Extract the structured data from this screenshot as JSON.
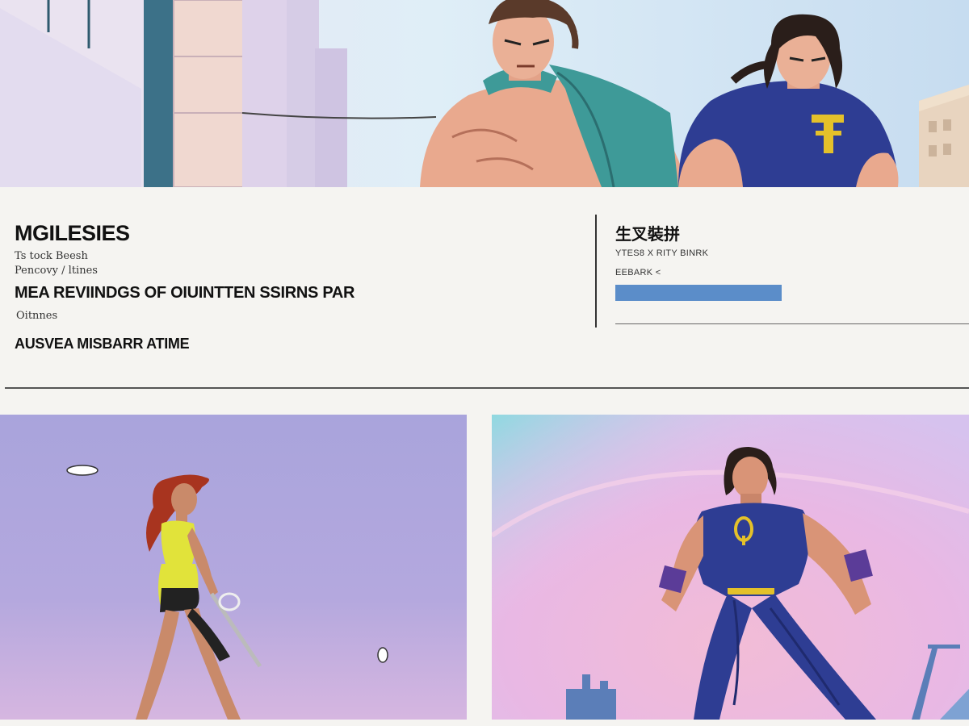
{
  "info": {
    "title": "MGILESIES",
    "meta_line_1": "Ts tock Beesh",
    "meta_line_2": "Pencovy / ltines",
    "headline": "MEA REVIINDGS OF OIUINTTEN SSIRNS PAR",
    "meta_line_3": "Oitnnes",
    "subheadline": "AUSVEA MISBARR ATIME"
  },
  "sidebar": {
    "title": "生叉裝拼",
    "meta_line_1": "YTES8 X RITY BINRK",
    "meta_line_2": "EEBARK <",
    "progress_fraction": 0.5
  },
  "colors": {
    "page_bg": "#f5f4f1",
    "accent_bar": "#5b8dc9",
    "hero_suit": "#2e3d93",
    "emblem": "#e4c12a",
    "cape_teal": "#3e9a98"
  },
  "icons": {
    "hero_emblem": "t-letter-emblem",
    "hero_emblem_2": "circle-emblem"
  }
}
